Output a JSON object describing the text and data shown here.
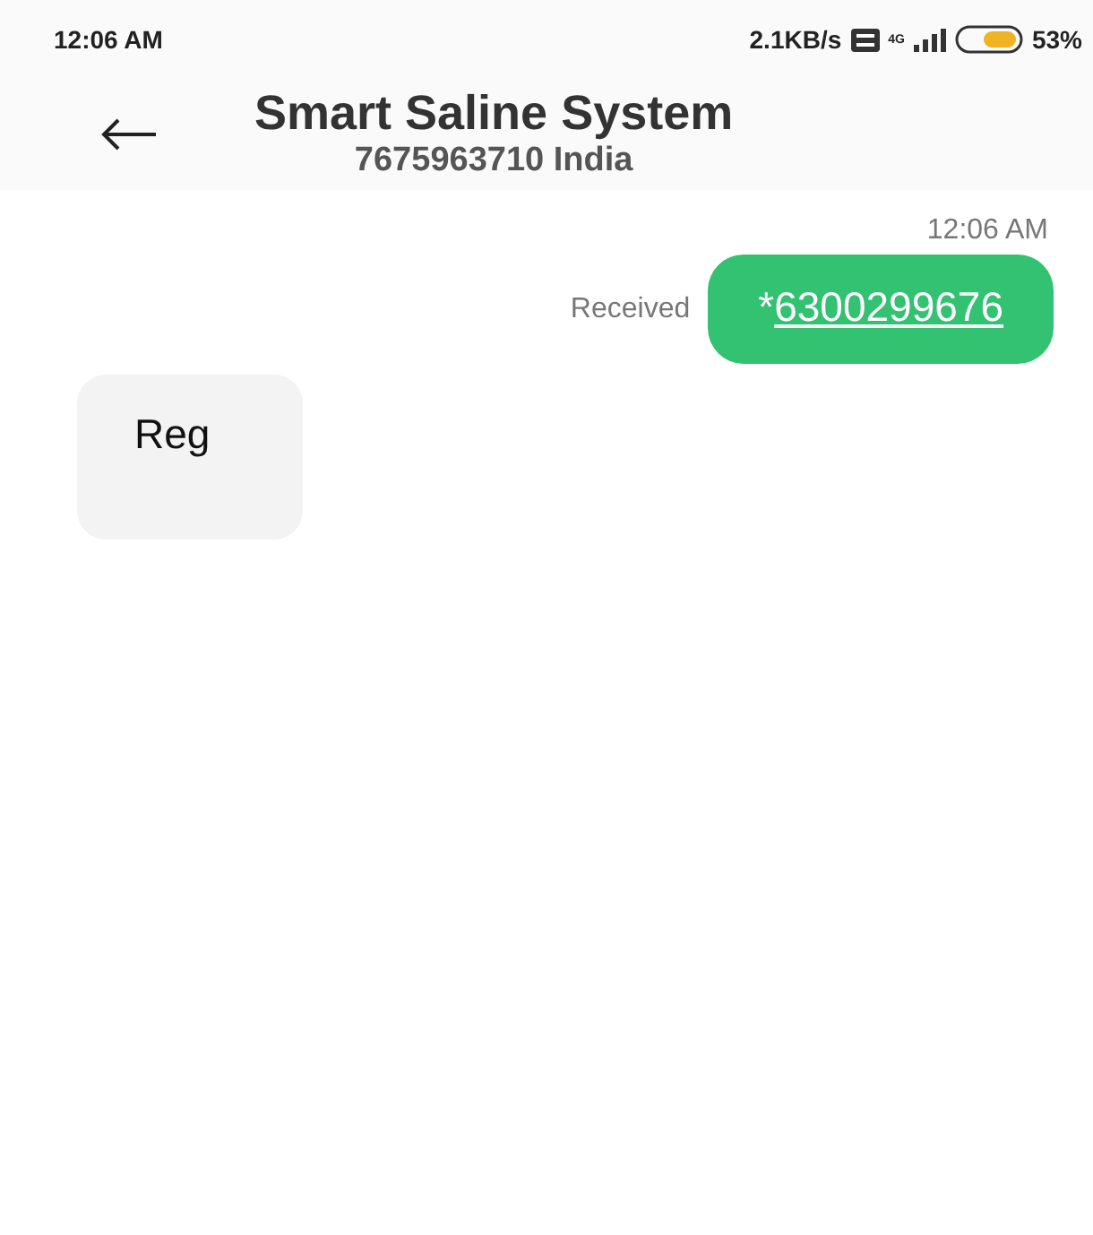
{
  "status_bar": {
    "time": "12:06 AM",
    "speed": "2.1KB/s",
    "network": "4G",
    "battery": "53%"
  },
  "header": {
    "title": "Smart Saline System",
    "subtitle": "7675963710 India"
  },
  "messages": [
    {
      "kind": "outgoing",
      "time": "12:06 AM",
      "status": "Received",
      "prefix": "*",
      "link": "6300299676"
    },
    {
      "kind": "incoming",
      "text": "Reg"
    }
  ]
}
